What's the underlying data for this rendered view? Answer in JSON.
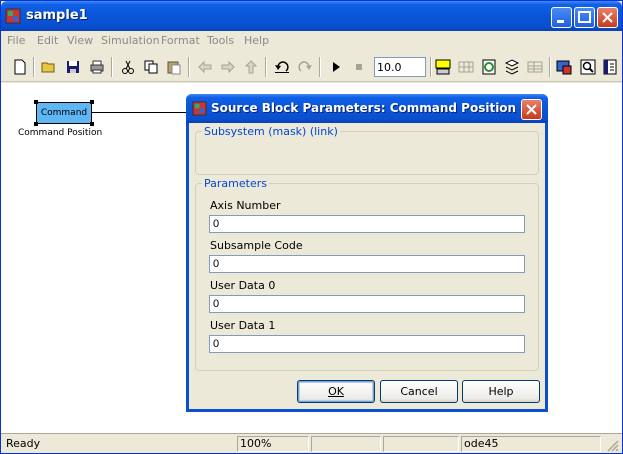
{
  "window": {
    "title": "sample1"
  },
  "menu": [
    {
      "label": "File"
    },
    {
      "label": "Edit"
    },
    {
      "label": "View"
    },
    {
      "label": "Simulation"
    },
    {
      "label": "Format"
    },
    {
      "label": "Tools"
    },
    {
      "label": "Help"
    }
  ],
  "toolbar": {
    "stop_time": "10.0"
  },
  "canvas": {
    "block_text": "Command",
    "block_label": "Command Position"
  },
  "status": {
    "state": "Ready",
    "zoom": "100%",
    "cell3": "",
    "cell4": "",
    "solver": "ode45"
  },
  "dialog": {
    "title": "Source Block Parameters: Command Position",
    "subsystem_group": "Subsystem (mask) (link)",
    "params_group": "Parameters",
    "fields": [
      {
        "label": "Axis Number",
        "value": "0"
      },
      {
        "label": "Subsample Code",
        "value": "0"
      },
      {
        "label": "User Data 0",
        "value": "0"
      },
      {
        "label": "User Data 1",
        "value": "0"
      }
    ],
    "buttons": {
      "ok": "OK",
      "cancel": "Cancel",
      "help": "Help"
    }
  },
  "colors": {
    "titlebar": "#0a55d8",
    "block_fill": "#5fb6f5",
    "group_label": "#0046d5"
  }
}
